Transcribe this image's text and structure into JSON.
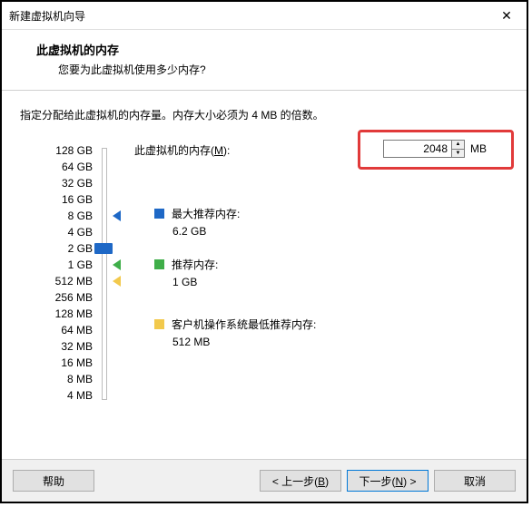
{
  "window": {
    "title": "新建虚拟机向导",
    "close_glyph": "✕"
  },
  "header": {
    "heading": "此虚拟机的内存",
    "sub": "您要为此虚拟机使用多少内存?"
  },
  "instruction": "指定分配给此虚拟机的内存量。内存大小必须为 4 MB 的倍数。",
  "memory": {
    "label_pre": "此虚拟机的内存(",
    "label_hot": "M",
    "label_post": "):",
    "value": "2048",
    "unit": "MB"
  },
  "slider_ticks": [
    "128 GB",
    "64 GB",
    "32 GB",
    "16 GB",
    "8 GB",
    "4 GB",
    "2 GB",
    "1 GB",
    "512 MB",
    "256 MB",
    "128 MB",
    "64 MB",
    "32 MB",
    "16 MB",
    "8 MB",
    "4 MB"
  ],
  "legend": {
    "max": {
      "label": "最大推荐内存:",
      "value": "6.2 GB"
    },
    "rec": {
      "label": "推荐内存:",
      "value": "1 GB"
    },
    "min": {
      "label": "客户机操作系统最低推荐内存:",
      "value": "512 MB"
    }
  },
  "buttons": {
    "help": "帮助",
    "back_pre": "< 上一步(",
    "back_hot": "B",
    "back_post": ")",
    "next_pre": "下一步(",
    "next_hot": "N",
    "next_post": ") >",
    "cancel": "取消"
  }
}
